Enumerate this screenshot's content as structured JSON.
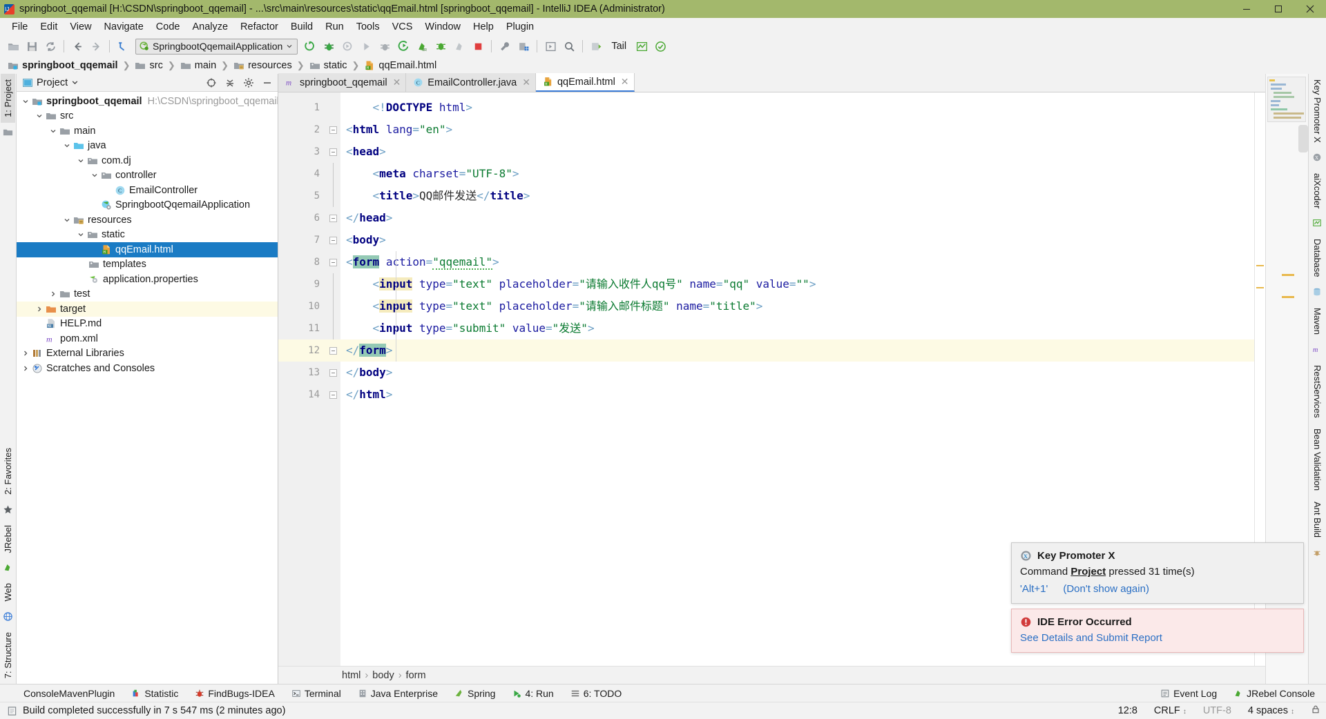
{
  "window": {
    "title": "springboot_qqemail [H:\\CSDN\\springboot_qqemail] - ...\\src\\main\\resources\\static\\qqEmail.html [springboot_qqemail] - IntelliJ IDEA (Administrator)",
    "minimize": "minimize-button",
    "maximize": "maximize-button",
    "close": "close-button"
  },
  "menubar": [
    {
      "label": "File"
    },
    {
      "label": "Edit"
    },
    {
      "label": "View"
    },
    {
      "label": "Navigate"
    },
    {
      "label": "Code"
    },
    {
      "label": "Analyze"
    },
    {
      "label": "Refactor"
    },
    {
      "label": "Build"
    },
    {
      "label": "Run"
    },
    {
      "label": "Tools"
    },
    {
      "label": "VCS"
    },
    {
      "label": "Window"
    },
    {
      "label": "Help"
    },
    {
      "label": "Plugin"
    }
  ],
  "toolbar": {
    "run_config": "SpringbootQqemailApplication",
    "tail_label": "Tail"
  },
  "breadcrumb": [
    {
      "label": "springboot_qqemail",
      "bold": true
    },
    {
      "label": "src",
      "bold": false
    },
    {
      "label": "main",
      "bold": false
    },
    {
      "label": "resources",
      "bold": false
    },
    {
      "label": "static",
      "bold": false
    },
    {
      "label": "qqEmail.html",
      "bold": false
    }
  ],
  "left_stripes": [
    {
      "label": "1: Project"
    },
    {
      "label": "2: Favorites"
    },
    {
      "label": "JRebel"
    },
    {
      "label": "Web"
    },
    {
      "label": "7: Structure"
    }
  ],
  "right_stripes": [
    {
      "label": "Key Promoter X"
    },
    {
      "label": "aiXcoder"
    },
    {
      "label": "Database"
    },
    {
      "label": "Maven"
    },
    {
      "label": "RestServices"
    },
    {
      "label": "Bean Validation"
    },
    {
      "label": "Ant Build"
    }
  ],
  "project_panel": {
    "title": "Project",
    "tree": [
      {
        "indent": 0,
        "arrow": "down",
        "icon": "module-icon",
        "label": "springboot_qqemail",
        "bold": true,
        "path": "H:\\CSDN\\springboot_qqemail"
      },
      {
        "indent": 1,
        "arrow": "down",
        "icon": "folder-icon",
        "label": "src"
      },
      {
        "indent": 2,
        "arrow": "down",
        "icon": "folder-icon",
        "label": "main"
      },
      {
        "indent": 3,
        "arrow": "down",
        "icon": "source-root-icon",
        "label": "java"
      },
      {
        "indent": 4,
        "arrow": "down",
        "icon": "package-icon",
        "label": "com.dj"
      },
      {
        "indent": 5,
        "arrow": "down",
        "icon": "package-icon",
        "label": "controller"
      },
      {
        "indent": 6,
        "arrow": "none",
        "icon": "java-class-icon",
        "label": "EmailController"
      },
      {
        "indent": 5,
        "arrow": "none",
        "icon": "spring-class-icon",
        "label": "SpringbootQqemailApplication"
      },
      {
        "indent": 3,
        "arrow": "down",
        "icon": "resource-root-icon",
        "label": "resources"
      },
      {
        "indent": 4,
        "arrow": "down",
        "icon": "package-icon",
        "label": "static"
      },
      {
        "indent": 5,
        "arrow": "none",
        "icon": "html-file-icon",
        "label": "qqEmail.html",
        "selected": true
      },
      {
        "indent": 4,
        "arrow": "none",
        "icon": "package-icon",
        "label": "templates"
      },
      {
        "indent": 4,
        "arrow": "none",
        "icon": "properties-file-icon",
        "label": "application.properties"
      },
      {
        "indent": 2,
        "arrow": "right",
        "icon": "folder-icon",
        "label": "test"
      },
      {
        "indent": 1,
        "arrow": "right",
        "icon": "target-folder-icon",
        "label": "target",
        "highlight": true
      },
      {
        "indent": 1,
        "arrow": "none",
        "icon": "md-file-icon",
        "label": "HELP.md"
      },
      {
        "indent": 1,
        "arrow": "none",
        "icon": "maven-file-icon",
        "label": "pom.xml"
      },
      {
        "indent": 0,
        "arrow": "right",
        "icon": "libraries-icon",
        "label": "External Libraries"
      },
      {
        "indent": 0,
        "arrow": "right",
        "icon": "scratches-icon",
        "label": "Scratches and Consoles"
      }
    ]
  },
  "editor_tabs": [
    {
      "label": "springboot_qqemail",
      "icon": "maven-file-icon",
      "active": false
    },
    {
      "label": "EmailController.java",
      "icon": "java-class-icon",
      "active": false
    },
    {
      "label": "qqEmail.html",
      "icon": "html-file-icon",
      "active": true
    }
  ],
  "code": {
    "lines": [
      {
        "n": 1,
        "fold": "none",
        "highlight": false,
        "text": "    <!DOCTYPE html>"
      },
      {
        "n": 2,
        "fold": "open",
        "highlight": false,
        "text": "<html lang=\"en\">"
      },
      {
        "n": 3,
        "fold": "open",
        "highlight": false,
        "text": "<head>"
      },
      {
        "n": 4,
        "fold": "none",
        "highlight": false,
        "text": "    <meta charset=\"UTF-8\">"
      },
      {
        "n": 5,
        "fold": "none",
        "highlight": false,
        "text": "    <title>QQ邮件发送</title>"
      },
      {
        "n": 6,
        "fold": "close",
        "highlight": false,
        "text": "</head>"
      },
      {
        "n": 7,
        "fold": "open",
        "highlight": false,
        "text": "<body>"
      },
      {
        "n": 8,
        "fold": "open",
        "highlight": false,
        "text": "<form action=\"qqemail\">"
      },
      {
        "n": 9,
        "fold": "none",
        "highlight": false,
        "text": "    <input type=\"text\" placeholder=\"请输入收件人qq号\" name=\"qq\" value=\"\">"
      },
      {
        "n": 10,
        "fold": "none",
        "highlight": false,
        "text": "    <input type=\"text\" placeholder=\"请输入邮件标题\" name=\"title\">"
      },
      {
        "n": 11,
        "fold": "none",
        "highlight": false,
        "text": "    <input type=\"submit\" value=\"发送\">"
      },
      {
        "n": 12,
        "fold": "close",
        "highlight": true,
        "text": "</form>"
      },
      {
        "n": 13,
        "fold": "close",
        "highlight": false,
        "text": "</body>"
      },
      {
        "n": 14,
        "fold": "close",
        "highlight": false,
        "text": "</html>"
      }
    ]
  },
  "editor_breadcrumb": [
    {
      "label": "html"
    },
    {
      "label": "body"
    },
    {
      "label": "form"
    }
  ],
  "bottom_tabs": [
    {
      "label": "ConsoleMavenPlugin",
      "icon": "none"
    },
    {
      "label": "Statistic",
      "icon": "statistic-icon"
    },
    {
      "label": "FindBugs-IDEA",
      "icon": "findbugs-icon"
    },
    {
      "label": "Terminal",
      "icon": "terminal-icon"
    },
    {
      "label": "Java Enterprise",
      "icon": "java-enterprise-icon"
    },
    {
      "label": "Spring",
      "icon": "spring-icon"
    },
    {
      "label": "4: Run",
      "icon": "run-icon"
    },
    {
      "label": "6: TODO",
      "icon": "todo-icon"
    }
  ],
  "bottom_right_tabs": [
    {
      "label": "Event Log",
      "icon": "event-log-icon"
    },
    {
      "label": "JRebel Console",
      "icon": "jrebel-icon"
    }
  ],
  "statusbar": {
    "message": "Build completed successfully in 7 s 547 ms (2 minutes ago)",
    "caret": "12:8",
    "line_separator": "CRLF",
    "encoding": "UTF-8",
    "indent": "4 spaces",
    "lock": "lock-icon"
  },
  "notifications": [
    {
      "id": "key-promoter-x",
      "title": "Key Promoter X",
      "body_prefix": "Command ",
      "body_bold": "Project",
      "body_suffix": " pressed 31 time(s)",
      "links": [
        "'Alt+1'",
        "(Don't show again)"
      ],
      "type": "info"
    },
    {
      "id": "ide-error",
      "title": "IDE Error Occurred",
      "links": [
        "See Details and Submit Report"
      ],
      "type": "error"
    }
  ],
  "colors": {
    "title_bar": "#a3b86c",
    "selection": "#1a7bc4",
    "error": "#d14343",
    "link": "#2a6fc4",
    "string": "#0a7a30",
    "tag": "#000080",
    "attribute": "#1a1aa0"
  }
}
